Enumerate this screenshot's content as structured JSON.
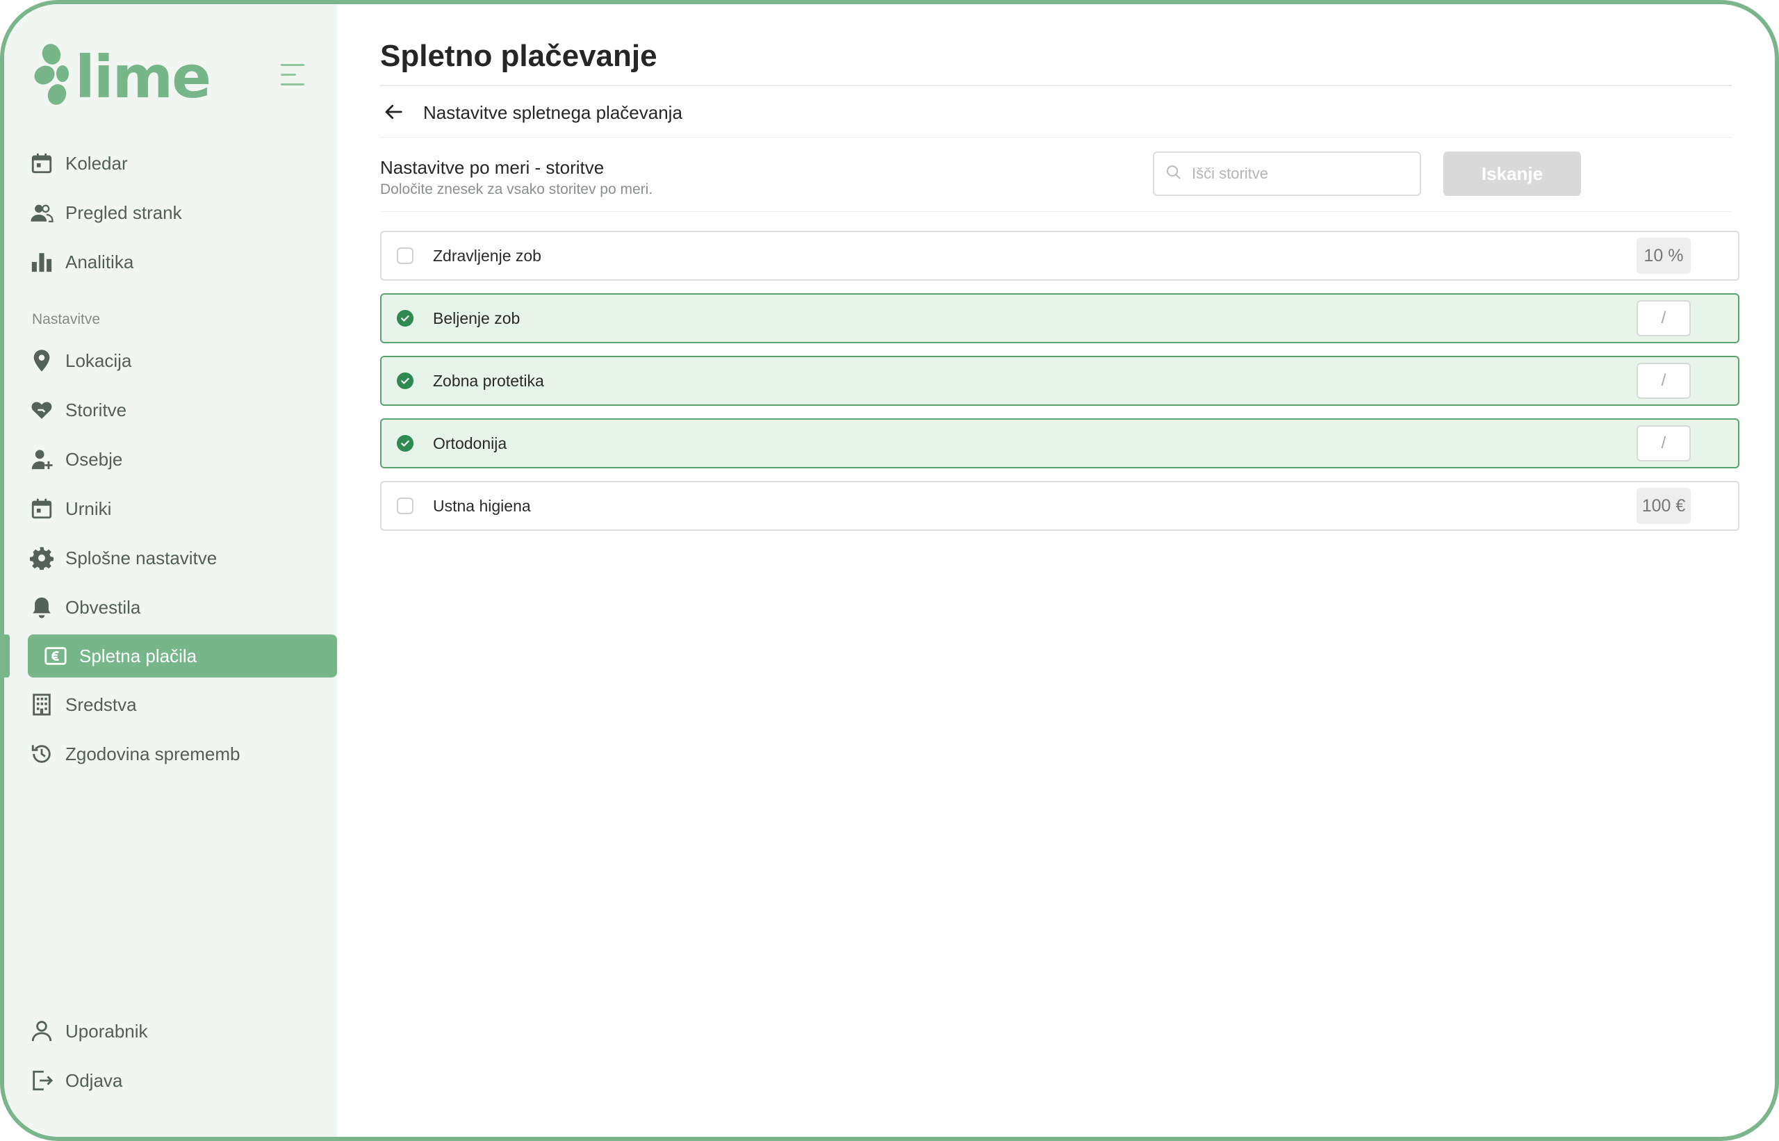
{
  "app": {
    "name": "lime",
    "brand_color": "#76b688"
  },
  "sidebar": {
    "items": [
      {
        "label": "Koledar",
        "icon": "calendar-icon"
      },
      {
        "label": "Pregled strank",
        "icon": "users-icon"
      },
      {
        "label": "Analitika",
        "icon": "bar-chart-icon"
      }
    ],
    "section_label": "Nastavitve",
    "settings_items": [
      {
        "label": "Lokacija",
        "icon": "location-pin-icon"
      },
      {
        "label": "Storitve",
        "icon": "heart-hand-icon"
      },
      {
        "label": "Osebje",
        "icon": "user-plus-icon"
      },
      {
        "label": "Urniki",
        "icon": "calendar-icon"
      },
      {
        "label": "Splošne nastavitve",
        "icon": "gear-icon"
      },
      {
        "label": "Obvestila",
        "icon": "bell-icon"
      },
      {
        "label": "Spletna plačila",
        "icon": "euro-card-icon",
        "active": true
      },
      {
        "label": "Sredstva",
        "icon": "building-icon"
      },
      {
        "label": "Zgodovina sprememb",
        "icon": "history-icon"
      }
    ],
    "bottom_items": [
      {
        "label": "Uporabnik",
        "icon": "user-icon"
      },
      {
        "label": "Odjava",
        "icon": "logout-icon"
      }
    ]
  },
  "main": {
    "title": "Spletno plačevanje",
    "breadcrumb": "Nastavitve spletnega plačevanja",
    "section_title": "Nastavitve po meri - storitve",
    "section_subtitle": "Določite znesek za vsako storitev po meri.",
    "search": {
      "placeholder": "Išči storitve",
      "value": "",
      "button_label": "Iskanje"
    },
    "services": [
      {
        "name": "Zdravljenje zob",
        "checked": false,
        "value": "10 %"
      },
      {
        "name": "Beljenje zob",
        "checked": true,
        "value": "/"
      },
      {
        "name": "Zobna protetika",
        "checked": true,
        "value": "/"
      },
      {
        "name": "Ortodonija",
        "checked": true,
        "value": "/"
      },
      {
        "name": "Ustna higiena",
        "checked": false,
        "value": "100 €"
      }
    ]
  }
}
